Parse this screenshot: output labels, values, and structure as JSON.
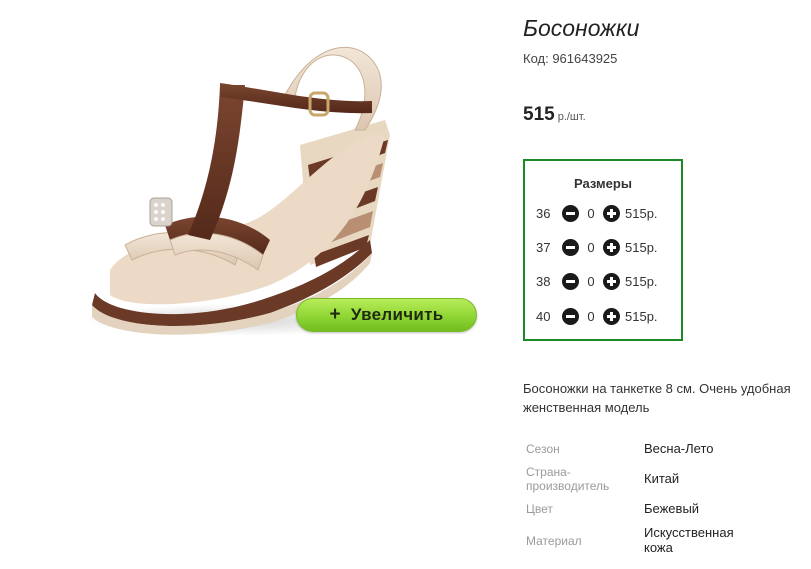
{
  "product": {
    "title": "Босоножки",
    "code": "Код: 961643925",
    "price_value": "515",
    "price_unit": "р./шт.",
    "zoom_button_label": "Увеличить",
    "zoom_button_icon": "+"
  },
  "sizes": {
    "title": "Размеры",
    "rows": [
      {
        "size": "36",
        "qty": "0",
        "price": "515р."
      },
      {
        "size": "37",
        "qty": "0",
        "price": "515р."
      },
      {
        "size": "38",
        "qty": "0",
        "price": "515р."
      },
      {
        "size": "40",
        "qty": "0",
        "price": "515р."
      }
    ]
  },
  "description": {
    "line1": "Босоножки на танкетке 8 см. Очень удобная",
    "line2": "женственная модель"
  },
  "specs": [
    {
      "label_1": "Сезон",
      "label_2": "",
      "value_1": "Весна-Лето",
      "value_2": ""
    },
    {
      "label_1": "Страна-",
      "label_2": "производитель",
      "value_1": "Китай",
      "value_2": ""
    },
    {
      "label_1": "Цвет",
      "label_2": "",
      "value_1": "Бежевый",
      "value_2": ""
    },
    {
      "label_1": "Материал",
      "label_2": "",
      "value_1": "Искусственная",
      "value_2": "кожа"
    }
  ],
  "colors": {
    "sizes_border": "#1b8a26",
    "zoom_button": "#8fd634",
    "strap_brown": "#6b3a26",
    "strap_beige": "#e9d9c6"
  }
}
